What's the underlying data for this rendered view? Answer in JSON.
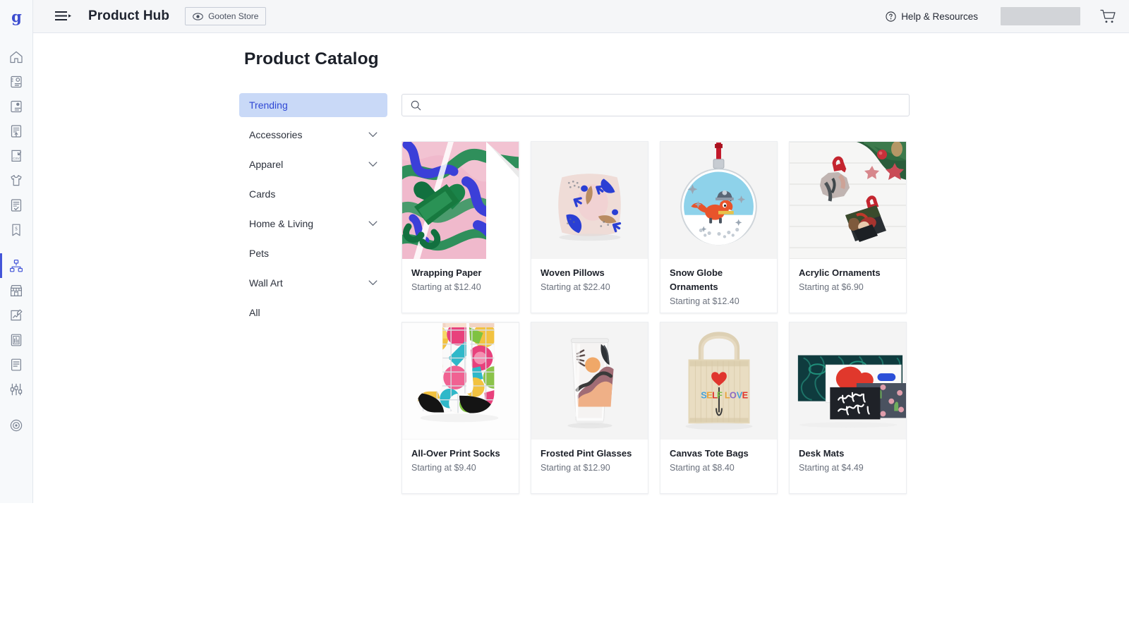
{
  "brand": {
    "logo_letter": "g",
    "accent_color": "#4355d8",
    "rail_bg": "#f7f9fb"
  },
  "topbar": {
    "app_title": "Product Hub",
    "store_chip_label": "Gooten Store",
    "help_label": "Help & Resources",
    "icons": {
      "hamburger": "menu-icon",
      "eye": "eye-icon",
      "help": "question-circle-icon",
      "cart": "shopping-cart-icon"
    },
    "account_placeholder": ""
  },
  "rail": {
    "items": [
      {
        "name": "home-icon",
        "active": false
      },
      {
        "name": "contact-card-icon",
        "active": false
      },
      {
        "name": "contact-card-alt-icon",
        "active": false
      },
      {
        "name": "document-upload-icon",
        "active": false
      },
      {
        "name": "csv-import-icon",
        "active": false
      },
      {
        "name": "tshirt-icon",
        "active": false
      },
      {
        "name": "document-check-icon",
        "active": false
      },
      {
        "name": "bookmark-dollar-icon",
        "active": false
      },
      {
        "name": "product-hub-icon",
        "active": true
      },
      {
        "name": "storefront-icon",
        "active": false
      },
      {
        "name": "analytics-edit-icon",
        "active": false
      },
      {
        "name": "report-chart-icon",
        "active": false
      },
      {
        "name": "document-lines-icon",
        "active": false
      },
      {
        "name": "settings-sliders-icon",
        "active": false
      },
      {
        "name": "target-icon",
        "active": false
      }
    ]
  },
  "page": {
    "title": "Product Catalog"
  },
  "search": {
    "value": "",
    "placeholder": ""
  },
  "categories": [
    {
      "label": "Trending",
      "expandable": false,
      "active": true
    },
    {
      "label": "Accessories",
      "expandable": true,
      "active": false
    },
    {
      "label": "Apparel",
      "expandable": true,
      "active": false
    },
    {
      "label": "Cards",
      "expandable": false,
      "active": false
    },
    {
      "label": "Home & Living",
      "expandable": true,
      "active": false
    },
    {
      "label": "Pets",
      "expandable": false,
      "active": false
    },
    {
      "label": "Wall Art",
      "expandable": true,
      "active": false
    },
    {
      "label": "All",
      "expandable": false,
      "active": false
    }
  ],
  "products": [
    {
      "name": "Wrapping Paper",
      "price": "Starting at $12.40",
      "art": "wrapping-paper"
    },
    {
      "name": "Woven Pillows",
      "price": "Starting at $22.40",
      "art": "pillow"
    },
    {
      "name": "Snow Globe Ornaments",
      "price": "Starting at $12.40",
      "art": "snowglobe"
    },
    {
      "name": "Acrylic Ornaments",
      "price": "Starting at $6.90",
      "art": "acrylic"
    },
    {
      "name": "All-Over Print Socks",
      "price": "Starting at $9.40",
      "art": "socks"
    },
    {
      "name": "Frosted Pint Glasses",
      "price": "Starting at $12.90",
      "art": "glass"
    },
    {
      "name": "Canvas Tote Bags",
      "price": "Starting at $8.40",
      "art": "tote"
    },
    {
      "name": "Desk Mats",
      "price": "Starting at $4.49",
      "art": "deskmat"
    }
  ]
}
